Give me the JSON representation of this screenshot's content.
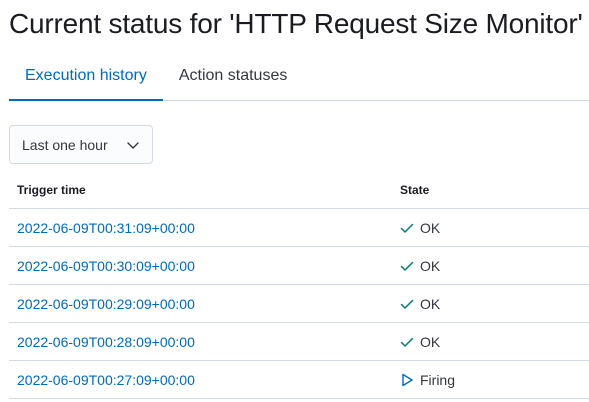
{
  "page": {
    "title": "Current status for 'HTTP Request Size Monitor'"
  },
  "tabs": [
    {
      "label": "Execution history",
      "active": true
    },
    {
      "label": "Action statuses",
      "active": false
    }
  ],
  "time_range": {
    "selected": "Last one hour",
    "icon": "chevron-down-icon"
  },
  "table": {
    "columns": [
      "Trigger time",
      "State"
    ],
    "rows": [
      {
        "trigger_time": "2022-06-09T00:31:09+00:00",
        "state": "OK",
        "state_icon": "check-icon"
      },
      {
        "trigger_time": "2022-06-09T00:30:09+00:00",
        "state": "OK",
        "state_icon": "check-icon"
      },
      {
        "trigger_time": "2022-06-09T00:29:09+00:00",
        "state": "OK",
        "state_icon": "check-icon"
      },
      {
        "trigger_time": "2022-06-09T00:28:09+00:00",
        "state": "OK",
        "state_icon": "check-icon"
      },
      {
        "trigger_time": "2022-06-09T00:27:09+00:00",
        "state": "Firing",
        "state_icon": "play-icon"
      }
    ]
  },
  "colors": {
    "link": "#006bb8",
    "border": "#d3dae6",
    "ok_icon": "#017d73",
    "firing_icon": "#006bb8"
  }
}
